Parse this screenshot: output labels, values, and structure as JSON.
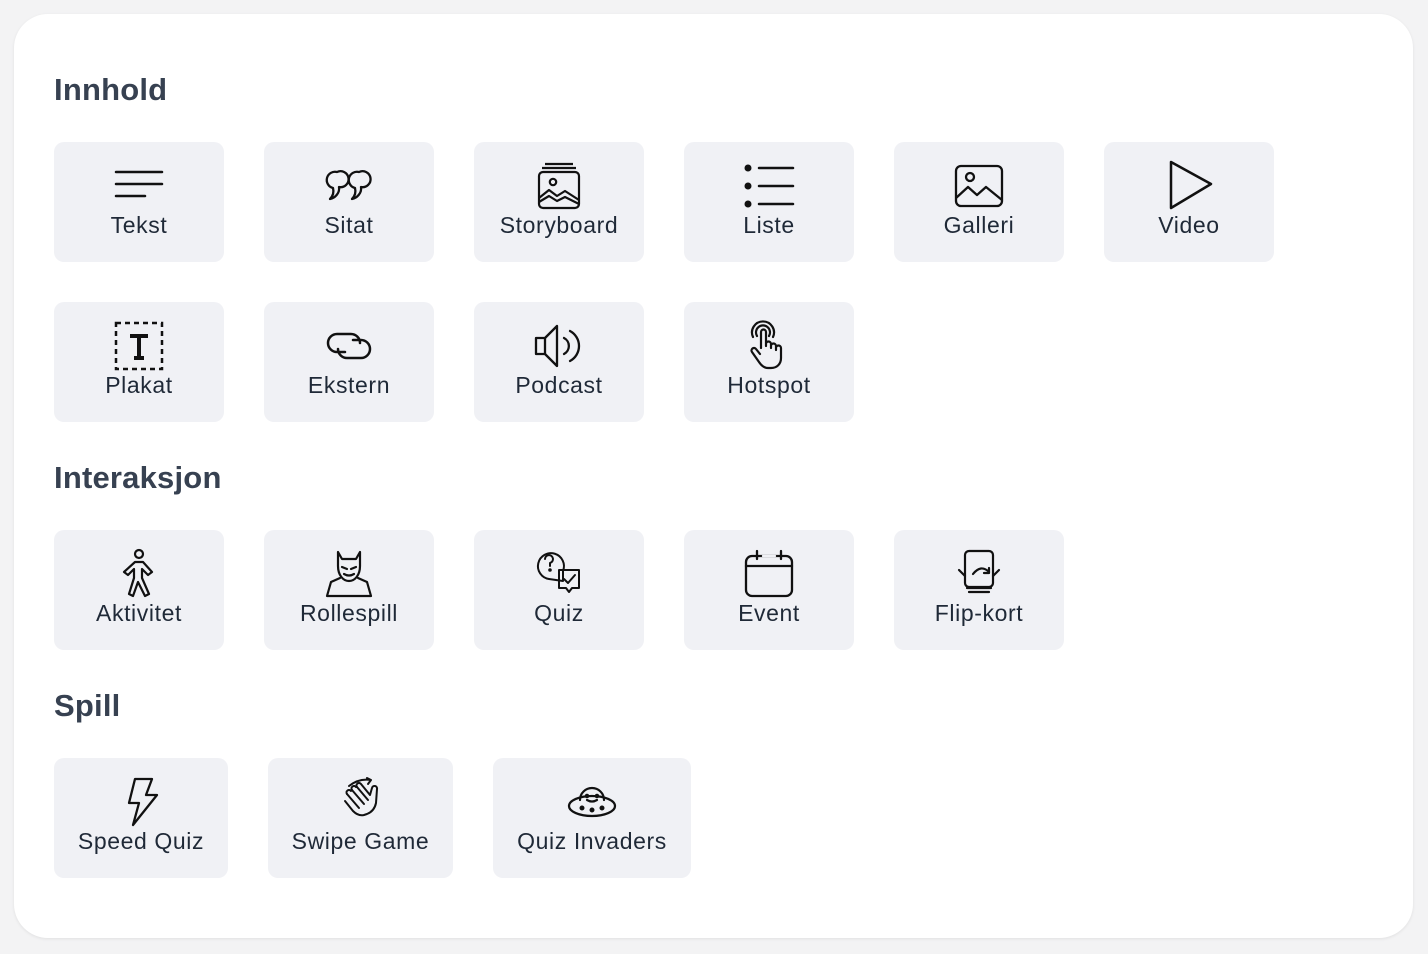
{
  "sections": {
    "innhold": {
      "title": "Innhold",
      "items": [
        {
          "label": "Tekst",
          "icon": "text-lines-icon"
        },
        {
          "label": "Sitat",
          "icon": "quote-icon"
        },
        {
          "label": "Storyboard",
          "icon": "storyboard-icon"
        },
        {
          "label": "Liste",
          "icon": "list-icon"
        },
        {
          "label": "Galleri",
          "icon": "image-icon"
        },
        {
          "label": "Video",
          "icon": "play-icon"
        },
        {
          "label": "Plakat",
          "icon": "poster-icon"
        },
        {
          "label": "Ekstern",
          "icon": "link-icon"
        },
        {
          "label": "Podcast",
          "icon": "speaker-icon"
        },
        {
          "label": "Hotspot",
          "icon": "tap-icon"
        }
      ]
    },
    "interaksjon": {
      "title": "Interaksjon",
      "items": [
        {
          "label": "Aktivitet",
          "icon": "walking-person-icon"
        },
        {
          "label": "Rollespill",
          "icon": "superhero-icon"
        },
        {
          "label": "Quiz",
          "icon": "question-check-icon"
        },
        {
          "label": "Event",
          "icon": "calendar-icon"
        },
        {
          "label": "Flip-kort",
          "icon": "flip-card-icon"
        }
      ]
    },
    "spill": {
      "title": "Spill",
      "items": [
        {
          "label": "Speed Quiz",
          "icon": "lightning-icon"
        },
        {
          "label": "Swipe Game",
          "icon": "swipe-hand-icon"
        },
        {
          "label": "Quiz Invaders",
          "icon": "ufo-icon"
        }
      ]
    }
  }
}
